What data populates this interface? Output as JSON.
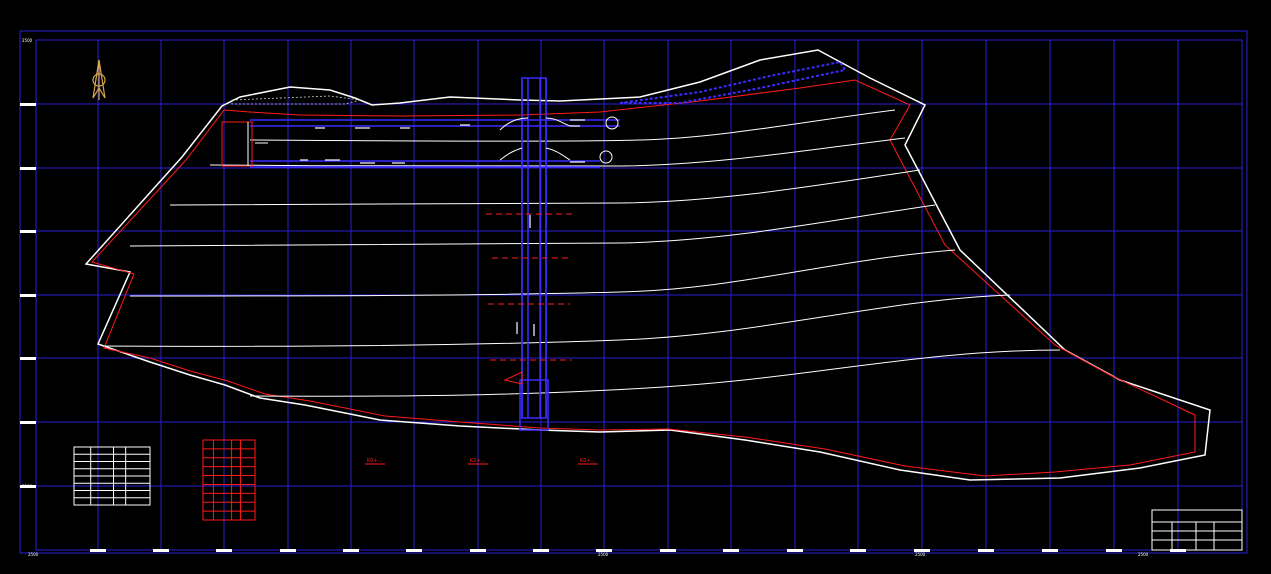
{
  "drawing": {
    "background_color": "#000000",
    "grid_color": "#2a1fd6",
    "boundary_color": "#ffffff",
    "redline_color": "#ff1a1a",
    "road_color": "#3a2bff",
    "frame_label_top": "2500",
    "frame_label_bottom": "2500",
    "axis_left_labels": [
      "2500",
      "2500"
    ],
    "axis_bottom_labels": [
      "2500",
      "2500",
      "2500",
      "2500"
    ]
  },
  "grid": {
    "columns": 20,
    "rows": 8
  },
  "station_labels": [
    "K0+...",
    "K0+...",
    "K0+..."
  ],
  "title_block": {
    "title": "",
    "rows": [
      [
        "",
        "",
        "",
        ""
      ],
      [
        "",
        "",
        "",
        ""
      ],
      [
        "",
        "",
        "",
        ""
      ]
    ]
  },
  "legend_table": {
    "rows": 8,
    "cols": 4
  },
  "red_table": {
    "rows": 9,
    "cols": 4
  }
}
